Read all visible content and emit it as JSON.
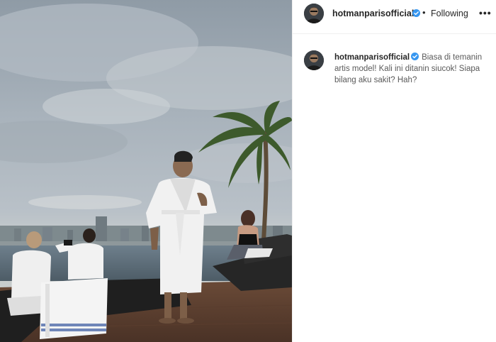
{
  "post": {
    "author": "hotmanparisofficial",
    "follow_state": "Following",
    "separator": "•",
    "more_label": "•••",
    "caption": "Biasa di temanin artis model! Kali ini ditanin siucok! Siapa bilang aku sakit? Hah?"
  },
  "icons": {
    "verified": "verified-badge-icon",
    "more": "more-options-icon"
  },
  "colors": {
    "verified": "#3897f0",
    "text": "#262626",
    "border": "#efefef"
  }
}
